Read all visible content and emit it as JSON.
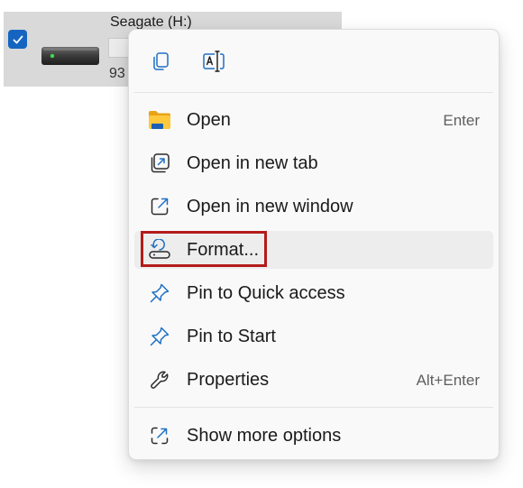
{
  "drive": {
    "name": "Seagate (H:)",
    "size_text": "93",
    "selected": true
  },
  "toolbar": {
    "copy_icon": "copy-icon",
    "rename_icon": "rename-icon"
  },
  "menu": {
    "items": [
      {
        "label": "Open",
        "shortcut": "Enter",
        "icon": "folder-icon"
      },
      {
        "label": "Open in new tab",
        "shortcut": "",
        "icon": "open-tab-icon"
      },
      {
        "label": "Open in new window",
        "shortcut": "",
        "icon": "open-window-icon"
      },
      {
        "label": "Format...",
        "shortcut": "",
        "icon": "format-icon"
      },
      {
        "label": "Pin to Quick access",
        "shortcut": "",
        "icon": "pin-icon"
      },
      {
        "label": "Pin to Start",
        "shortcut": "",
        "icon": "pin-icon"
      },
      {
        "label": "Properties",
        "shortcut": "Alt+Enter",
        "icon": "wrench-icon"
      }
    ],
    "more": {
      "label": "Show more options",
      "icon": "show-more-icon"
    }
  },
  "colors": {
    "accent": "#1565c0",
    "highlight_border": "#b31b1b",
    "menu_bg": "#f9f9f9",
    "hover_bg": "#ededed"
  }
}
